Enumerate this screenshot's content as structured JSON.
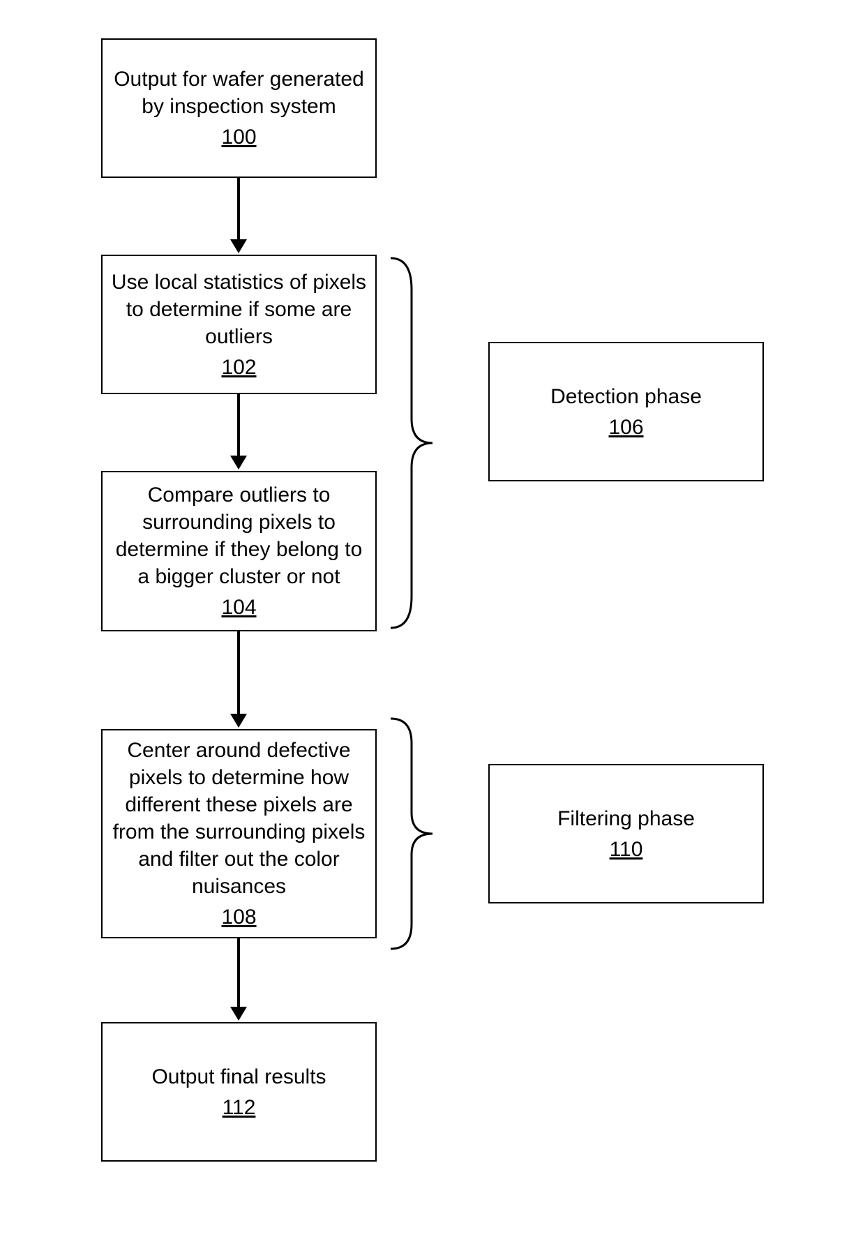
{
  "boxes": {
    "b100": {
      "text": "Output for wafer generated by inspection system",
      "ref": "100"
    },
    "b102": {
      "text": "Use local statistics of pixels to determine if some are outliers",
      "ref": "102"
    },
    "b104": {
      "text": "Compare outliers to surrounding pixels to determine if they belong to a bigger cluster or not",
      "ref": "104"
    },
    "b108": {
      "text": "Center around defective pixels to determine how different these pixels are from the surrounding pixels and filter out the color nuisances",
      "ref": "108"
    },
    "b112": {
      "text": "Output final results",
      "ref": "112"
    },
    "b106": {
      "text": "Detection phase",
      "ref": "106"
    },
    "b110": {
      "text": "Filtering phase",
      "ref": "110"
    }
  }
}
